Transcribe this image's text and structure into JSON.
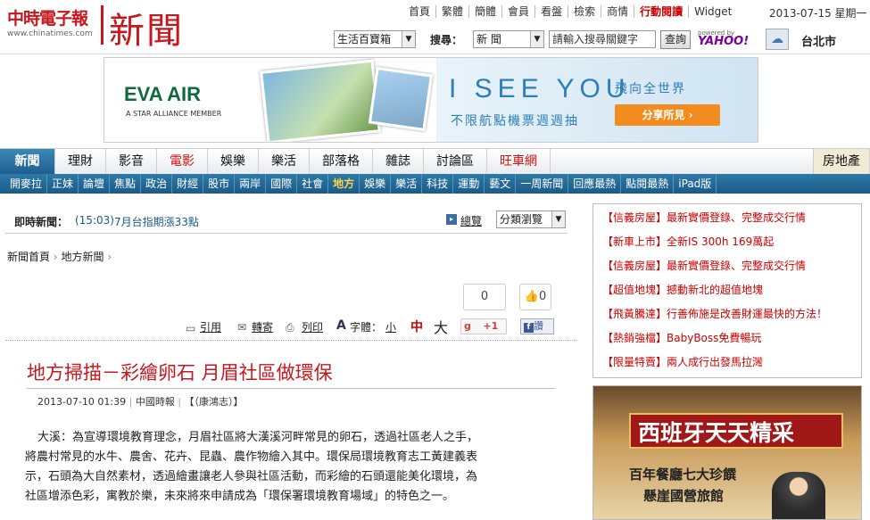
{
  "site": {
    "logo_text": "中時電子報",
    "logo_url_text": "www.chinatimes.com",
    "section_title": "新聞"
  },
  "top_links": [
    "首頁",
    "繁體",
    "簡體",
    "會員",
    "看盤",
    "檢索",
    "商情",
    "行動閱讀",
    "Widget"
  ],
  "date": "2013-07-15 星期一",
  "search": {
    "category_select": "生活百寶箱",
    "search_label": "搜尋：",
    "scope_select": "新 聞",
    "input_placeholder": "請輸入搜尋關鍵字",
    "button": "查詢",
    "powered_by": "powered by",
    "yahoo": "YAHOO!"
  },
  "weather": {
    "city": "台北市"
  },
  "ad": {
    "brand": "EVA AIR",
    "tagline": "A STAR ALLIANCE MEMBER",
    "headline": "I SEE YOU",
    "sub1": "飛向全世界",
    "sub2": "不限航點機票週週抽",
    "share": "分享所見 ›"
  },
  "nav_main": [
    "新聞",
    "理財",
    "影音",
    "電影",
    "娛樂",
    "樂活",
    "部落格",
    "雜誌",
    "討論區",
    "旺車網"
  ],
  "nav_main_right": "房地產",
  "nav_sub": [
    "開麥拉",
    "正妹",
    "論壇",
    "焦點",
    "政治",
    "財經",
    "股市",
    "兩岸",
    "國際",
    "社會",
    "地方",
    "娛樂",
    "樂活",
    "科技",
    "運動",
    "藝文",
    "一周新聞",
    "回應最熱",
    "點閱最熱",
    "iPad版"
  ],
  "breaking": {
    "label": "即時新聞：",
    "time": "(15:03)",
    "text": "7月台指期漲33點",
    "overview": "總覽",
    "browse_select": "分類瀏覽"
  },
  "breadcrumb": [
    "新聞首頁",
    "地方新聞"
  ],
  "counters": {
    "comments": "0",
    "likes": "0"
  },
  "tools": {
    "quote": "引用",
    "forward": "轉寄",
    "print": "列印",
    "font_label": "字體：",
    "small": "小",
    "medium": "中",
    "large": "大",
    "gplus": "+1",
    "fb": "讚"
  },
  "article": {
    "title": "地方掃描－彩繪卵石 月眉社區做環保",
    "date": "2013-07-10 01:39",
    "source": "中國時報",
    "author": "【（康鴻志）】",
    "body": [
      "大溪：為宣導環境教育理念，月眉社區將大漢溪河畔常見的卵石，透過社區老人之手，",
      "將農村常見的水牛、農舍、花卉、昆蟲、農作物繪入其中。環保局環境教育志工黃建義表",
      "示，石頭為大自然素材，透過繪畫讓老人參與社區活動，而彩繪的石頭還能美化環境，為",
      "社區增添色彩，寓教於樂，未來將來申請成為「環保署環境教育場域」的特色之一。"
    ]
  },
  "sidebar_links": [
    {
      "tag": "【信義房屋】",
      "text": "最新實價登錄、完整成交行情"
    },
    {
      "tag": "【新車上市】",
      "text": "全新IS 300h 169萬起"
    },
    {
      "tag": "【信義房屋】",
      "text": "最新實價登錄、完整成交行情"
    },
    {
      "tag": "【超值地塊】",
      "text": "撼動新北的超值地塊"
    },
    {
      "tag": "【飛黃騰達】",
      "text": "行善佈施是改善財運最快的方法！"
    },
    {
      "tag": "【熱銷強檔】",
      "text": "BabyBoss免費暢玩"
    },
    {
      "tag": "【限量特賣】",
      "text": "兩人成行出發馬拉灣"
    }
  ],
  "side_ad": {
    "title": "西班牙天天精采",
    "sub1": "百年餐廳七大珍饌",
    "sub2": "懸崖國營旅館"
  }
}
